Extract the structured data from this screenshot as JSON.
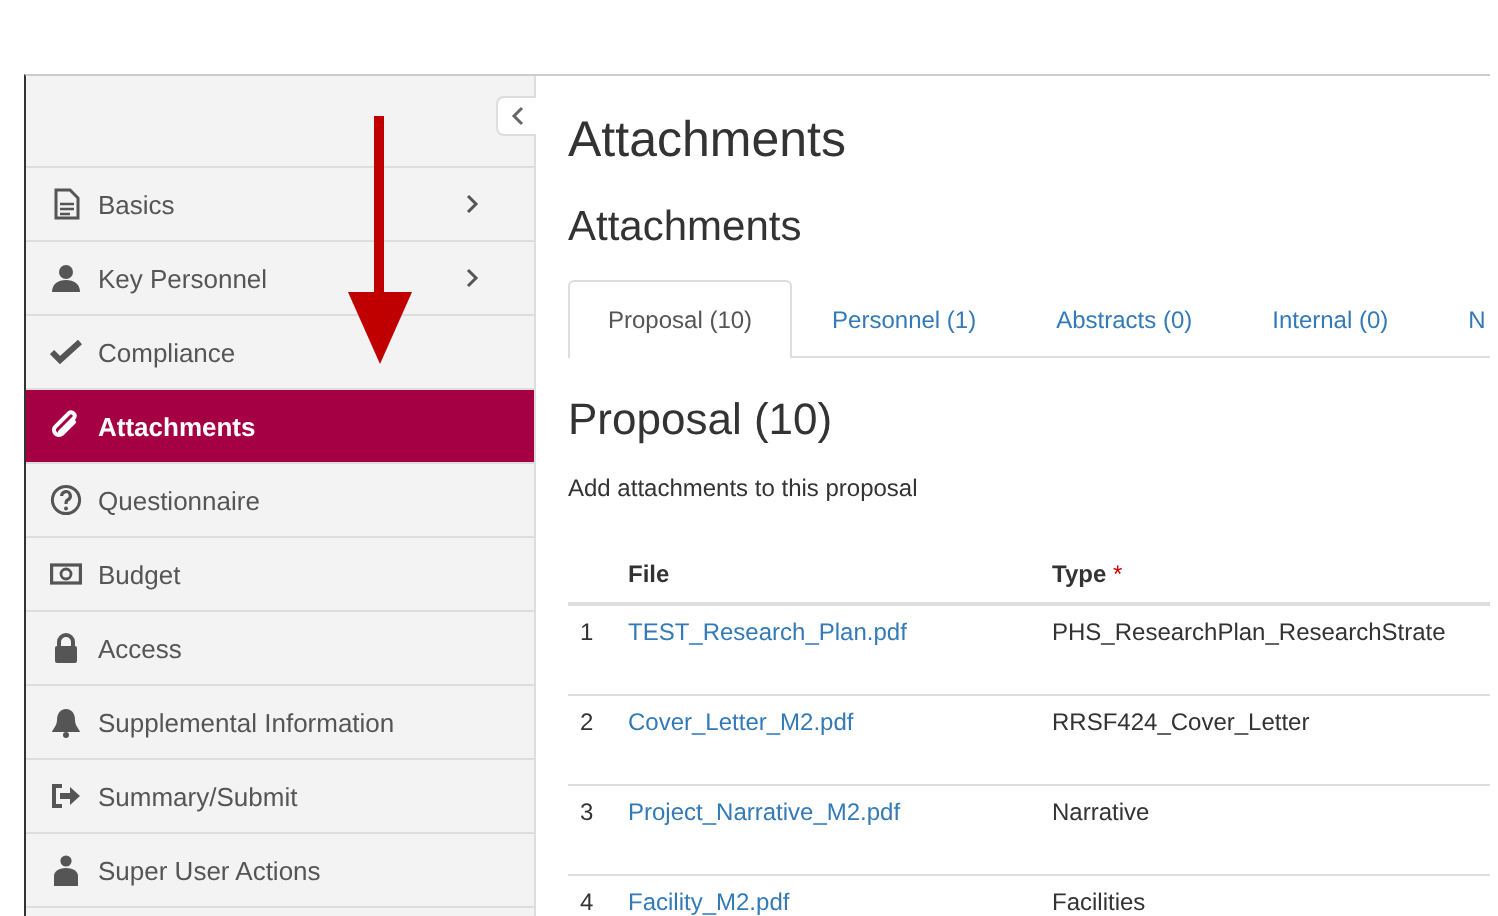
{
  "sidebar": {
    "items": [
      {
        "label": "Basics",
        "expandable": true,
        "selected": false
      },
      {
        "label": "Key Personnel",
        "expandable": true,
        "selected": false
      },
      {
        "label": "Compliance",
        "expandable": false,
        "selected": false
      },
      {
        "label": "Attachments",
        "expandable": false,
        "selected": true
      },
      {
        "label": "Questionnaire",
        "expandable": false,
        "selected": false
      },
      {
        "label": "Budget",
        "expandable": false,
        "selected": false
      },
      {
        "label": "Access",
        "expandable": false,
        "selected": false
      },
      {
        "label": "Supplemental Information",
        "expandable": false,
        "selected": false
      },
      {
        "label": "Summary/Submit",
        "expandable": false,
        "selected": false
      },
      {
        "label": "Super User Actions",
        "expandable": false,
        "selected": false
      }
    ]
  },
  "page_title": "Attachments",
  "section_title": "Attachments",
  "tabs": [
    {
      "label": "Proposal (10)",
      "selected": true
    },
    {
      "label": "Personnel (1)",
      "selected": false
    },
    {
      "label": "Abstracts (0)",
      "selected": false
    },
    {
      "label": "Internal (0)",
      "selected": false
    },
    {
      "label": "N",
      "selected": false
    }
  ],
  "panel": {
    "title": "Proposal (10)",
    "description": "Add attachments to this proposal"
  },
  "table": {
    "columns": [
      {
        "label": "File"
      },
      {
        "label": "Type",
        "required_marker": "*"
      }
    ],
    "rows": [
      {
        "number": "1",
        "file": "TEST_Research_Plan.pdf",
        "type": "PHS_ResearchPlan_ResearchStrate"
      },
      {
        "number": "2",
        "file": "Cover_Letter_M2.pdf",
        "type": "RRSF424_Cover_Letter"
      },
      {
        "number": "3",
        "file": "Project_Narrative_M2.pdf",
        "type": "Narrative"
      },
      {
        "number": "4",
        "file": "Facility_M2.pdf",
        "type": "Facilities"
      }
    ]
  }
}
